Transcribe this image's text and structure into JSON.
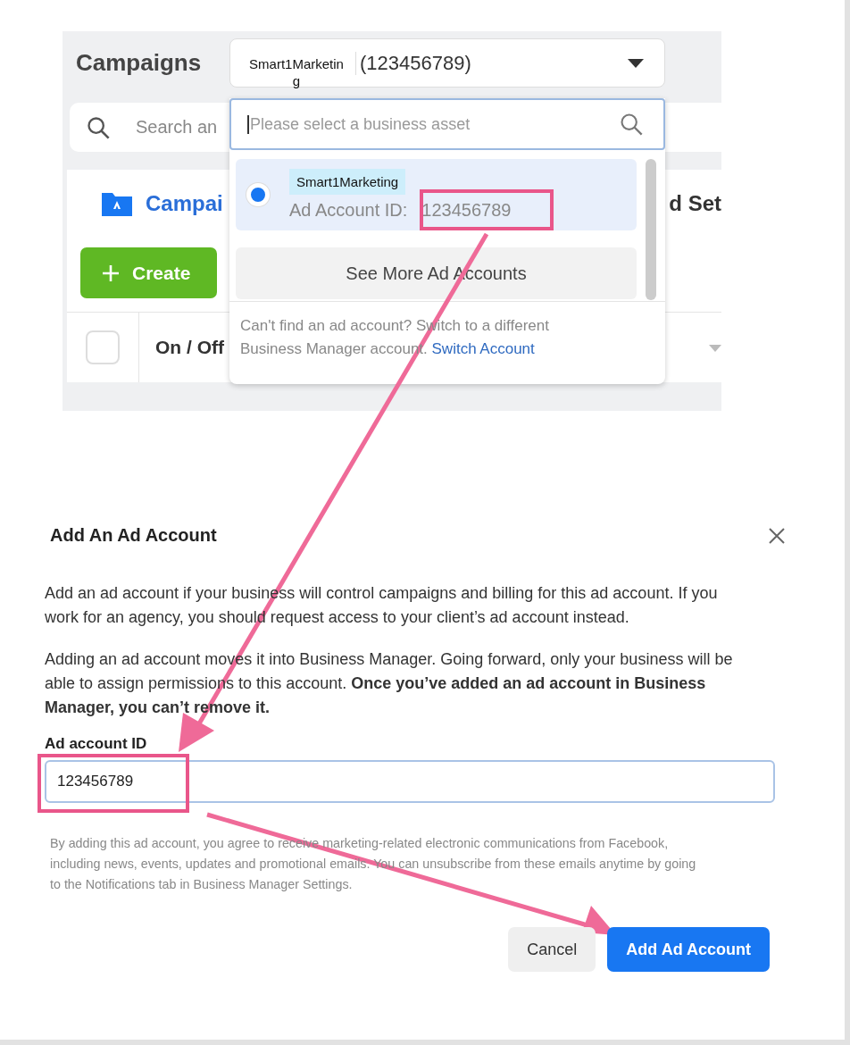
{
  "header": {
    "title": "Campaigns",
    "account_selector": {
      "name": "Smart1Marketing",
      "id": "(123456789)"
    }
  },
  "search": {
    "placeholder": "Search an"
  },
  "tabs": [
    {
      "label": "Campai",
      "selected": true
    },
    {
      "label": "d Set",
      "selected": false
    }
  ],
  "create_button": {
    "label": "Create"
  },
  "table": {
    "select_all": {
      "checked": false
    },
    "columns": [
      "On / Off"
    ]
  },
  "dropdown": {
    "placeholder": "Please select a business asset",
    "items": [
      {
        "name": "Smart1Marketing",
        "id_label": "Ad Account ID:",
        "id": "123456789",
        "selected": true
      }
    ],
    "more_button": "See More Ad Accounts",
    "footer": "Can't find an ad account? Switch to a different Business Manager account.",
    "footer_link": "Switch Account"
  },
  "dialog": {
    "title": "Add An Ad Account",
    "paragraphs": [
      "Add an ad account if your business will control campaigns and billing for this ad account. If you work for an agency, you should request access to your client’s ad account instead.",
      "Adding an ad account moves it into Business Manager. Going forward, only your business will be able to assign permissions to this account. **Once you’ve added an ad account in Business Manager, you can’t remove it.**"
    ],
    "field_label": "Ad account ID",
    "field_value": "123456789",
    "disclaimer": "By adding this ad account, you agree to receive marketing-related electronic communications from Facebook, including news, events, updates and promotional emails. You can unsubscribe from these emails anytime by going to the Notifications tab in Business Manager Settings.",
    "buttons": [
      {
        "label": "Cancel",
        "kind": "secondary"
      },
      {
        "label": "Add Ad Account",
        "kind": "primary"
      }
    ]
  }
}
